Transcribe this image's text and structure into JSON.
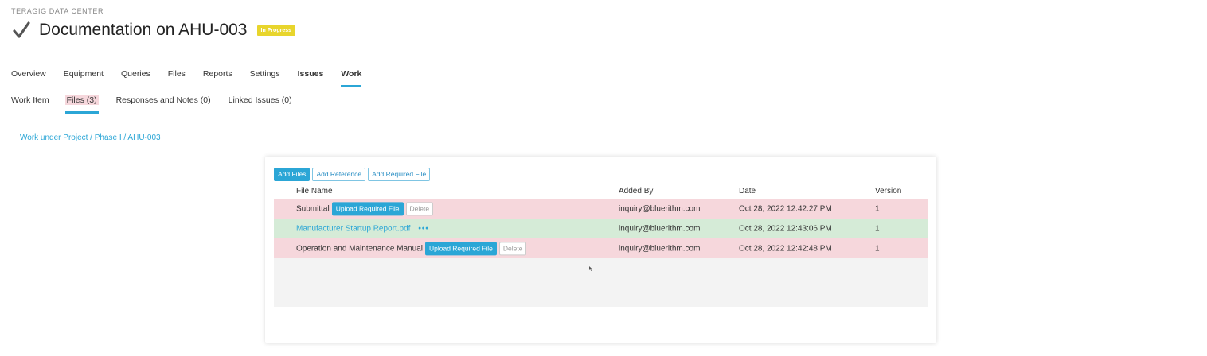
{
  "header": {
    "org": "TERAGIG DATA CENTER",
    "title": "Documentation on AHU-003",
    "status": "In Progress"
  },
  "tabs": [
    {
      "label": "Overview"
    },
    {
      "label": "Equipment"
    },
    {
      "label": "Queries"
    },
    {
      "label": "Files"
    },
    {
      "label": "Reports"
    },
    {
      "label": "Settings"
    },
    {
      "label": "Issues"
    },
    {
      "label": "Work"
    }
  ],
  "subtabs": [
    {
      "label": "Work Item"
    },
    {
      "label": "Files (3)"
    },
    {
      "label": "Responses and Notes (0)"
    },
    {
      "label": "Linked Issues (0)"
    }
  ],
  "breadcrumb": "Work under Project / Phase I / AHU-003",
  "toolbar": {
    "add_files": "Add Files",
    "add_reference": "Add Reference",
    "add_required_file": "Add Required File"
  },
  "table": {
    "columns": [
      "File Name",
      "Added By",
      "Date",
      "Version"
    ],
    "rows": [
      {
        "name": "Submittal",
        "added_by": "inquiry@bluerithm.com",
        "date": "Oct 28, 2022 12:42:27 PM",
        "version": "1",
        "upload_label": "Upload Required File",
        "delete_label": "Delete"
      },
      {
        "name": "Manufacturer Startup Report.pdf",
        "added_by": "inquiry@bluerithm.com",
        "date": "Oct 28, 2022 12:43:06 PM",
        "version": "1",
        "more": "•••"
      },
      {
        "name": "Operation and Maintenance Manual",
        "added_by": "inquiry@bluerithm.com",
        "date": "Oct 28, 2022 12:42:48 PM",
        "version": "1",
        "upload_label": "Upload Required File",
        "delete_label": "Delete"
      }
    ]
  },
  "colors": {
    "accent": "#2ba6d6",
    "badge": "#e8d52c",
    "row_required": "#f6d7dc",
    "row_uploaded": "#d5ebd7"
  },
  "icons": {
    "title": "checkmark-icon",
    "more": "more-dots-icon",
    "cursor": "mouse-cursor-icon"
  }
}
